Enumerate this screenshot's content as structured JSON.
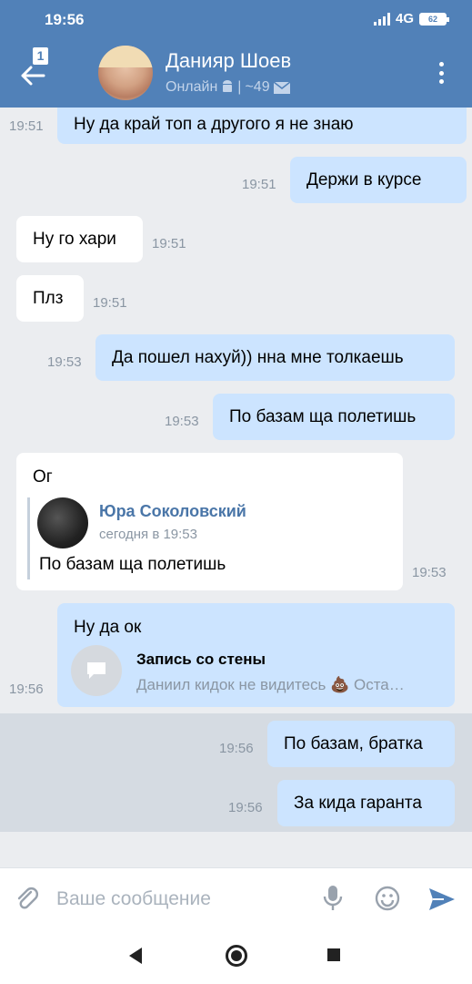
{
  "status_bar": {
    "time": "19:56",
    "network": "4G",
    "battery": "62"
  },
  "header": {
    "back_badge": "1",
    "title": "Данияр Шоев",
    "status": "Онлайн",
    "separator": "|",
    "count": "~49"
  },
  "messages": [
    {
      "dir": "out",
      "text": "Ну да край топ а другого я не знаю",
      "time": "19:51"
    },
    {
      "dir": "out",
      "text": "Держи в курсе",
      "time": "19:51"
    },
    {
      "dir": "in",
      "text": "Ну го хари",
      "time": "19:51"
    },
    {
      "dir": "in",
      "text": "Плз",
      "time": "19:51"
    },
    {
      "dir": "out",
      "text": "Да пошел нахуй)) нна мне толкаешь",
      "time": "19:53"
    },
    {
      "dir": "out",
      "text": "По базам ща полетишь",
      "time": "19:53"
    },
    {
      "dir": "in",
      "text": "Ог",
      "time": "19:53",
      "forward": {
        "author": "Юра Соколовский",
        "date": "сегодня в 19:53",
        "text": "По базам ща полетишь"
      }
    },
    {
      "dir": "out",
      "text": "Ну да ок",
      "time": "19:56",
      "attachment": {
        "title": "Запись со стены",
        "subtitle": "Даниил кидок не видитесь 💩 Оста…"
      }
    },
    {
      "dir": "out",
      "text": "По базам, братка",
      "time": "19:56"
    },
    {
      "dir": "out",
      "text": "За кида гаранта",
      "time": "19:56"
    }
  ],
  "composer": {
    "placeholder": "Ваше сообщение"
  },
  "colors": {
    "header": "#5181b8",
    "outgoing": "#cce4ff",
    "incoming": "#ffffff",
    "background": "#ebedf0",
    "link": "#4a76a8"
  }
}
